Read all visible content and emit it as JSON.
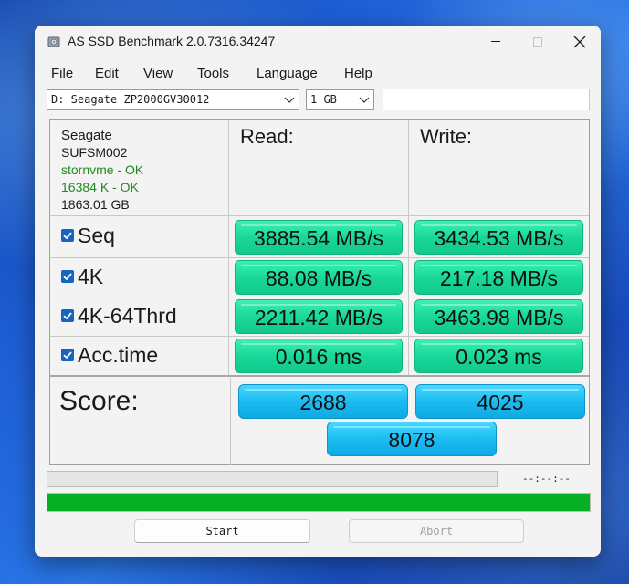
{
  "window": {
    "title": "AS SSD Benchmark 2.0.7316.34247"
  },
  "menu": [
    "File",
    "Edit",
    "View",
    "Tools",
    "Language",
    "Help"
  ],
  "drive_select": {
    "value": "D: Seagate ZP2000GV30012"
  },
  "size_select": {
    "value": "1 GB"
  },
  "drive_info": {
    "vendor": "Seagate",
    "model": "SUFSM002",
    "driver": "stornvme - OK",
    "alignment": "16384 K - OK",
    "capacity": "1863.01 GB"
  },
  "columns": {
    "read": "Read:",
    "write": "Write:"
  },
  "rows": [
    {
      "label": "Seq",
      "checked": true,
      "read": "3885.54 MB/s",
      "write": "3434.53 MB/s"
    },
    {
      "label": "4K",
      "checked": true,
      "read": "88.08 MB/s",
      "write": "217.18 MB/s"
    },
    {
      "label": "4K-64Thrd",
      "checked": true,
      "read": "2211.42 MB/s",
      "write": "3463.98 MB/s"
    },
    {
      "label": "Acc.time",
      "checked": true,
      "read": "0.016 ms",
      "write": "0.023 ms"
    }
  ],
  "score": {
    "label": "Score:",
    "read": "2688",
    "write": "4025",
    "total": "8078"
  },
  "elapsed": "--:--:--",
  "progress": {
    "total_percent": 100
  },
  "buttons": {
    "start": "Start",
    "abort": "Abort"
  },
  "colors": {
    "result_green": "#19d89a",
    "score_blue": "#1bbcf2",
    "ok_text": "#1f8a1f",
    "progress_fill": "#06b025",
    "checkbox": "#1565c0"
  }
}
